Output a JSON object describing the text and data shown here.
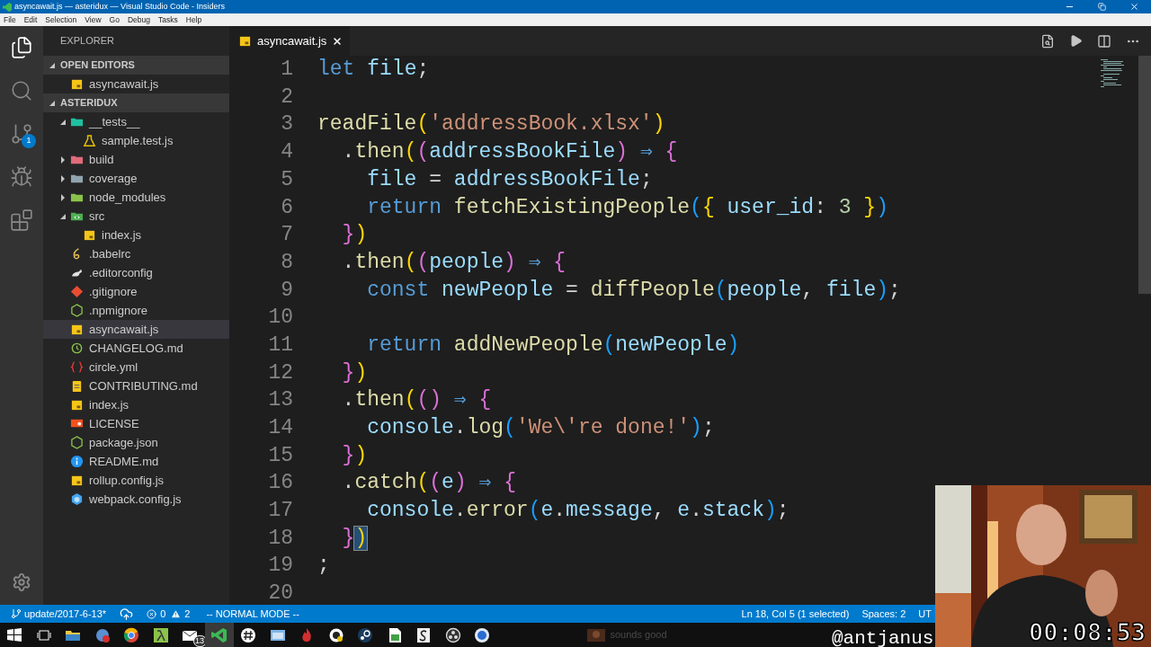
{
  "window": {
    "title": "asyncawait.js — asteridux — Visual Studio Code - Insiders"
  },
  "menu": [
    "File",
    "Edit",
    "Selection",
    "View",
    "Go",
    "Debug",
    "Tasks",
    "Help"
  ],
  "activity_bar": [
    {
      "kind": "files",
      "selected": true
    },
    {
      "kind": "search",
      "selected": false
    },
    {
      "kind": "scm",
      "selected": false,
      "badge": "1"
    },
    {
      "kind": "debug",
      "selected": false
    },
    {
      "kind": "extensions",
      "selected": false
    }
  ],
  "sidebar": {
    "title": "EXPLORER",
    "sections": [
      {
        "title": "OPEN EDITORS",
        "expanded": true,
        "items": [
          {
            "label": "asyncawait.js",
            "kind": "js",
            "selected": false
          }
        ]
      },
      {
        "title": "ASTERIDUX",
        "expanded": true,
        "items": [
          {
            "label": "__tests__",
            "kind": "folder-test",
            "expanded": true,
            "selected": false,
            "children": [
              {
                "label": "sample.test.js",
                "kind": "test",
                "selected": false
              }
            ]
          },
          {
            "label": "build",
            "kind": "folder-build",
            "expanded": false,
            "selected": false
          },
          {
            "label": "coverage",
            "kind": "folder",
            "expanded": false,
            "selected": false
          },
          {
            "label": "node_modules",
            "kind": "folder-node",
            "expanded": false,
            "selected": false
          },
          {
            "label": "src",
            "kind": "folder-src",
            "expanded": true,
            "selected": false,
            "children": [
              {
                "label": "index.js",
                "kind": "js",
                "selected": false
              }
            ]
          },
          {
            "label": ".babelrc",
            "kind": "babel",
            "selected": false
          },
          {
            "label": ".editorconfig",
            "kind": "editorconfig",
            "selected": false
          },
          {
            "label": ".gitignore",
            "kind": "git",
            "selected": false
          },
          {
            "label": ".npmignore",
            "kind": "node",
            "selected": false
          },
          {
            "label": "asyncawait.js",
            "kind": "js",
            "selected": true
          },
          {
            "label": "CHANGELOG.md",
            "kind": "changelog",
            "selected": false
          },
          {
            "label": "circle.yml",
            "kind": "yaml",
            "selected": false
          },
          {
            "label": "CONTRIBUTING.md",
            "kind": "contributing",
            "selected": false
          },
          {
            "label": "index.js",
            "kind": "js",
            "selected": false
          },
          {
            "label": "LICENSE",
            "kind": "license",
            "selected": false
          },
          {
            "label": "package.json",
            "kind": "node",
            "selected": false
          },
          {
            "label": "README.md",
            "kind": "info",
            "selected": false
          },
          {
            "label": "rollup.config.js",
            "kind": "js",
            "selected": false
          },
          {
            "label": "webpack.config.js",
            "kind": "webpack",
            "selected": false
          }
        ]
      }
    ]
  },
  "tabs": [
    {
      "label": "asyncawait.js",
      "kind": "js",
      "selected": true
    }
  ],
  "editor": {
    "lines": [
      {
        "number": "1",
        "tokens": [
          {
            "kind": "kw",
            "t": "let "
          },
          {
            "kind": "var",
            "t": "file"
          },
          {
            "kind": "p",
            "t": ";"
          }
        ]
      },
      {
        "number": "2"
      },
      {
        "number": "3",
        "tokens": [
          {
            "kind": "fn",
            "t": "readFile"
          },
          {
            "kind": "b1",
            "t": "("
          },
          {
            "kind": "str",
            "t": "'addressBook.xlsx'"
          },
          {
            "kind": "b1",
            "t": ")"
          }
        ]
      },
      {
        "number": "4",
        "tokens": [
          {
            "kind": "p",
            "t": "  ."
          },
          {
            "kind": "fn",
            "t": "then"
          },
          {
            "kind": "b1",
            "t": "("
          },
          {
            "kind": "b2",
            "t": "("
          },
          {
            "kind": "var",
            "t": "addressBookFile"
          },
          {
            "kind": "b2",
            "t": ")"
          },
          {
            "kind": "kw",
            "t": " ⇒ "
          },
          {
            "kind": "b2",
            "t": "{"
          }
        ]
      },
      {
        "number": "5",
        "tokens": [
          {
            "kind": "var",
            "t": "    file"
          },
          {
            "kind": "p",
            "t": " = "
          },
          {
            "kind": "var",
            "t": "addressBookFile"
          },
          {
            "kind": "p",
            "t": ";"
          }
        ]
      },
      {
        "number": "6",
        "tokens": [
          {
            "kind": "kw",
            "t": "    return "
          },
          {
            "kind": "fn",
            "t": "fetchExistingPeople"
          },
          {
            "kind": "b3",
            "t": "("
          },
          {
            "kind": "b1",
            "t": "{"
          },
          {
            "kind": "var",
            "t": " user_id"
          },
          {
            "kind": "p",
            "t": ": "
          },
          {
            "kind": "num",
            "t": "3"
          },
          {
            "kind": "b1",
            "t": " }"
          },
          {
            "kind": "b3",
            "t": ")"
          }
        ]
      },
      {
        "number": "7",
        "tokens": [
          {
            "kind": "b2",
            "t": "  }"
          },
          {
            "kind": "b1",
            "t": ")"
          }
        ]
      },
      {
        "number": "8",
        "tokens": [
          {
            "kind": "p",
            "t": "  ."
          },
          {
            "kind": "fn",
            "t": "then"
          },
          {
            "kind": "b1",
            "t": "("
          },
          {
            "kind": "b2",
            "t": "("
          },
          {
            "kind": "var",
            "t": "people"
          },
          {
            "kind": "b2",
            "t": ")"
          },
          {
            "kind": "kw",
            "t": " ⇒ "
          },
          {
            "kind": "b2",
            "t": "{"
          }
        ]
      },
      {
        "number": "9",
        "tokens": [
          {
            "kind": "kw",
            "t": "    const "
          },
          {
            "kind": "var",
            "t": "newPeople"
          },
          {
            "kind": "p",
            "t": " = "
          },
          {
            "kind": "fn",
            "t": "diffPeople"
          },
          {
            "kind": "b3",
            "t": "("
          },
          {
            "kind": "var",
            "t": "people"
          },
          {
            "kind": "p",
            "t": ", "
          },
          {
            "kind": "var",
            "t": "file"
          },
          {
            "kind": "b3",
            "t": ")"
          },
          {
            "kind": "p",
            "t": ";"
          }
        ]
      },
      {
        "number": "10"
      },
      {
        "number": "11",
        "tokens": [
          {
            "kind": "kw",
            "t": "    return "
          },
          {
            "kind": "fn",
            "t": "addNewPeople"
          },
          {
            "kind": "b3",
            "t": "("
          },
          {
            "kind": "var",
            "t": "newPeople"
          },
          {
            "kind": "b3",
            "t": ")"
          }
        ]
      },
      {
        "number": "12",
        "tokens": [
          {
            "kind": "b2",
            "t": "  }"
          },
          {
            "kind": "b1",
            "t": ")"
          }
        ]
      },
      {
        "number": "13",
        "tokens": [
          {
            "kind": "p",
            "t": "  ."
          },
          {
            "kind": "fn",
            "t": "then"
          },
          {
            "kind": "b1",
            "t": "("
          },
          {
            "kind": "b2",
            "t": "()"
          },
          {
            "kind": "kw",
            "t": " ⇒ "
          },
          {
            "kind": "b2",
            "t": "{"
          }
        ]
      },
      {
        "number": "14",
        "tokens": [
          {
            "kind": "var",
            "t": "    console"
          },
          {
            "kind": "p",
            "t": "."
          },
          {
            "kind": "fn",
            "t": "log"
          },
          {
            "kind": "b3",
            "t": "("
          },
          {
            "kind": "str",
            "t": "'We\\'re done!'"
          },
          {
            "kind": "b3",
            "t": ")"
          },
          {
            "kind": "p",
            "t": ";"
          }
        ]
      },
      {
        "number": "15",
        "tokens": [
          {
            "kind": "b2",
            "t": "  }"
          },
          {
            "kind": "b1",
            "t": ")"
          }
        ]
      },
      {
        "number": "16",
        "tokens": [
          {
            "kind": "p",
            "t": "  ."
          },
          {
            "kind": "fn",
            "t": "catch"
          },
          {
            "kind": "b1",
            "t": "("
          },
          {
            "kind": "b2",
            "t": "("
          },
          {
            "kind": "var",
            "t": "e"
          },
          {
            "kind": "b2",
            "t": ")"
          },
          {
            "kind": "kw",
            "t": " ⇒ "
          },
          {
            "kind": "b2",
            "t": "{"
          }
        ]
      },
      {
        "number": "17",
        "tokens": [
          {
            "kind": "var",
            "t": "    console"
          },
          {
            "kind": "p",
            "t": "."
          },
          {
            "kind": "fn",
            "t": "error"
          },
          {
            "kind": "b3",
            "t": "("
          },
          {
            "kind": "var",
            "t": "e"
          },
          {
            "kind": "p",
            "t": "."
          },
          {
            "kind": "var",
            "t": "message"
          },
          {
            "kind": "p",
            "t": ", "
          },
          {
            "kind": "var",
            "t": "e"
          },
          {
            "kind": "p",
            "t": "."
          },
          {
            "kind": "var",
            "t": "stack"
          },
          {
            "kind": "b3",
            "t": ")"
          },
          {
            "kind": "p",
            "t": ";"
          }
        ]
      },
      {
        "number": "18",
        "tokens": [
          {
            "kind": "b2",
            "t": "  }"
          },
          {
            "kind": "sel",
            "t": ")"
          }
        ]
      },
      {
        "number": "19",
        "tokens": [
          {
            "kind": "p",
            "t": ";"
          }
        ]
      },
      {
        "number": "20"
      }
    ]
  },
  "status_bar": {
    "branch": "update/2017-6-13*",
    "errors": "0",
    "warnings": "2",
    "mode": "-- NORMAL MODE --",
    "position": "Ln 18, Col 5 (1 selected)",
    "indent": "Spaces: 2",
    "encoding": "UT"
  },
  "taskbar": {
    "items": [
      {
        "kind": "start",
        "active": false
      },
      {
        "kind": "taskview",
        "active": false
      },
      {
        "kind": "folder",
        "active": false
      },
      {
        "kind": "globe",
        "active": false
      },
      {
        "kind": "circle",
        "active": false
      },
      {
        "kind": "lambda",
        "active": false
      },
      {
        "kind": "mail",
        "active": false,
        "badge": "13"
      },
      {
        "kind": "code",
        "active": true
      },
      {
        "kind": "hash",
        "active": false
      },
      {
        "kind": "window",
        "active": false
      },
      {
        "kind": "flame",
        "active": false
      },
      {
        "kind": "paint",
        "active": false
      },
      {
        "kind": "steam",
        "active": false
      },
      {
        "kind": "sheet",
        "active": false
      },
      {
        "kind": "letter",
        "active": false
      },
      {
        "kind": "aperture",
        "active": false
      },
      {
        "kind": "dot",
        "active": false
      }
    ],
    "chat_preview": "sounds good"
  },
  "overlay": {
    "handle": "@antjanus",
    "timer": "00:08:53"
  }
}
